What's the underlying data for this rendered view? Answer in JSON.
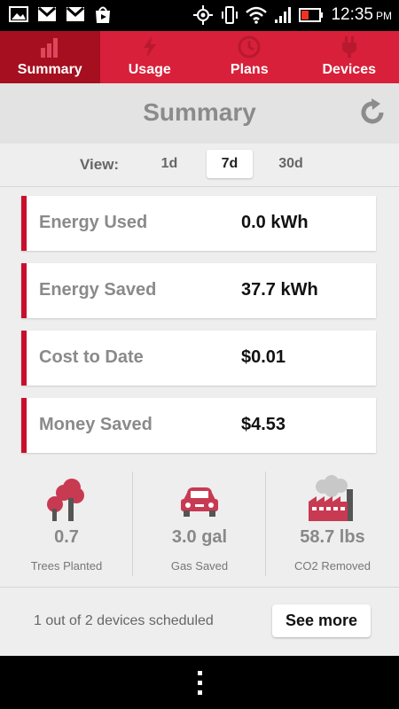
{
  "status_bar": {
    "time": "12:35",
    "ampm": "PM",
    "icons": [
      "image-icon",
      "gmail-icon",
      "gmail-icon",
      "play-store-icon",
      "gps-icon",
      "vibrate-icon",
      "wifi-icon",
      "signal-icon",
      "battery-icon"
    ]
  },
  "tabs": [
    {
      "label": "Summary",
      "icon": "bar-chart-icon",
      "active": true
    },
    {
      "label": "Usage",
      "icon": "lightning-icon",
      "active": false
    },
    {
      "label": "Plans",
      "icon": "clock-icon",
      "active": false
    },
    {
      "label": "Devices",
      "icon": "plug-icon",
      "active": false
    }
  ],
  "header": {
    "title": "Summary",
    "refresh_icon": "refresh-icon"
  },
  "view": {
    "label": "View:",
    "options": [
      "1d",
      "7d",
      "30d"
    ],
    "selected": "7d"
  },
  "cards": [
    {
      "label": "Energy Used",
      "value": "0.0 kWh"
    },
    {
      "label": "Energy Saved",
      "value": "37.7 kWh"
    },
    {
      "label": "Cost to Date",
      "value": "$0.01"
    },
    {
      "label": "Money Saved",
      "value": "$4.53"
    }
  ],
  "stats": [
    {
      "icon": "trees-icon",
      "value": "0.7",
      "label": "Trees Planted"
    },
    {
      "icon": "car-icon",
      "value": "3.0 gal",
      "label": "Gas Saved"
    },
    {
      "icon": "factory-icon",
      "value": "58.7 lbs",
      "label": "CO2 Removed"
    }
  ],
  "footer": {
    "text": "1 out of 2 devices scheduled",
    "button": "See more"
  },
  "colors": {
    "accent": "#d8203a",
    "accent_dark": "#a50f1f",
    "card_bar": "#c8102e",
    "stat_icon": "#c83a52"
  }
}
